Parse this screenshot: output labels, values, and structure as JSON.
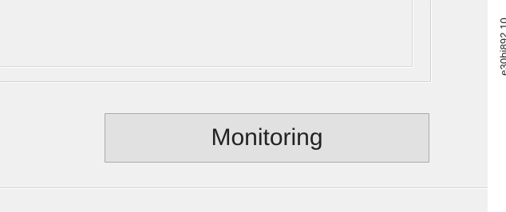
{
  "dialog": {
    "primary_button_label": "Monitoring"
  },
  "figure": {
    "reference_code": "e30bi892.10"
  }
}
